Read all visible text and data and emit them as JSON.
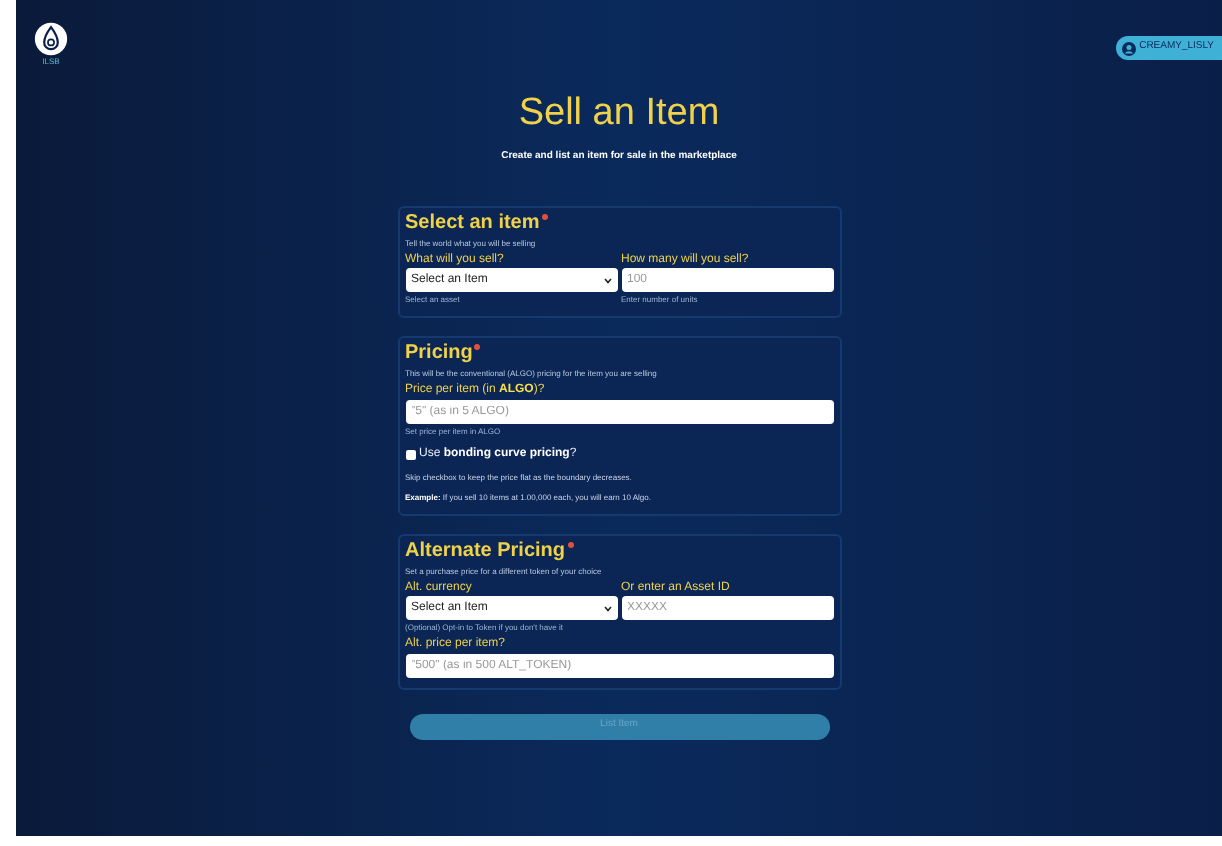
{
  "header": {
    "logo_label": "ILSB",
    "user": "CREAMY_LISLY"
  },
  "title": "Sell an Item",
  "subtitle": "Create and list an item for sale in the marketplace",
  "sections": [
    {
      "title": "Select an item",
      "required": true,
      "description": "Tell the world what you will be selling",
      "rows": [
        [
          {
            "kind": "select",
            "label": "What will you sell?",
            "value": "Select an Item",
            "hint": "Select an asset"
          },
          {
            "kind": "input",
            "label": "How many will you sell?",
            "placeholder": "100",
            "hint": "Enter number of units"
          }
        ]
      ]
    },
    {
      "title": "Pricing",
      "required": true,
      "description": "This will be the conventional (ALGO) pricing for the item you are selling",
      "rows": [
        [
          {
            "kind": "input",
            "label": "Price per item (in **ALGO**)?",
            "placeholder": "\"5\" (as in 5 ALGO)",
            "hint": "Set price per item in ALGO"
          }
        ],
        [
          {
            "kind": "checkbox",
            "label": "Use **bonding curve pricing**?",
            "checked": false
          }
        ],
        [
          {
            "kind": "note",
            "text": "Skip checkbox to keep the price flat as the boundary decreases."
          }
        ],
        [
          {
            "kind": "note",
            "text": "**Example:** If you sell 10 items at 1.00,000 each, you will earn 10 Algo."
          }
        ]
      ]
    },
    {
      "title": "Alternate Pricing",
      "required": true,
      "description": "Set a purchase price for a different token of your choice",
      "rows": [
        [
          {
            "kind": "select",
            "label": "Alt. currency",
            "value": "Select an Item",
            "hint": "(Optional) Opt-in to Token if you don't have it"
          },
          {
            "kind": "input",
            "label": "Or enter an Asset ID",
            "placeholder": "XXXXX"
          }
        ],
        [
          {
            "kind": "input",
            "label": "Alt. price per item?",
            "placeholder": "\"500\" (as in 500 ALT_TOKEN)"
          }
        ]
      ]
    }
  ],
  "submit": {
    "label": "List Item",
    "disabled": true
  }
}
